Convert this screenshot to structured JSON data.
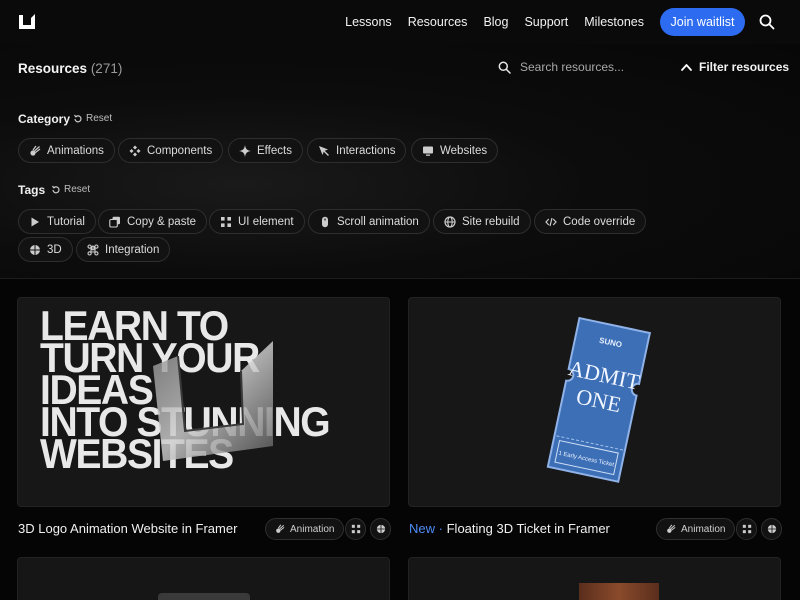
{
  "nav": {
    "links": [
      "Lessons",
      "Resources",
      "Blog",
      "Support",
      "Milestones"
    ],
    "join_label": "Join waitlist"
  },
  "resources": {
    "title": "Resources",
    "count": "(271)",
    "search_placeholder": "Search resources...",
    "filter_label": "Filter resources"
  },
  "category": {
    "label": "Category",
    "reset_label": "Reset",
    "chips": [
      "Animations",
      "Components",
      "Effects",
      "Interactions",
      "Websites"
    ]
  },
  "tags": {
    "label": "Tags",
    "reset_label": "Reset",
    "chips": [
      "Tutorial",
      "Copy & paste",
      "UI element",
      "Scroll animation",
      "Site rebuild",
      "Code override",
      "3D",
      "Integration"
    ]
  },
  "cards": [
    {
      "title": "3D Logo Animation Website in Framer",
      "image_text": [
        "LEARN TO",
        "TURN YOUR",
        "IDEAS",
        "INTO STUNNING",
        "WEBSITES"
      ],
      "chip": "Animation",
      "badge": ""
    },
    {
      "title": "Floating 3D Ticket in Framer",
      "badge": "New",
      "separator": "·",
      "chip": "Animation",
      "ticket": {
        "brand": "SUNO",
        "line1": "ADMIT",
        "line2": "ONE",
        "stub": "1 Early Access Ticket"
      }
    }
  ],
  "colors": {
    "accent": "#2d6cf0",
    "new_badge": "#4d8bf5",
    "ticket": "#3d6fb6"
  }
}
